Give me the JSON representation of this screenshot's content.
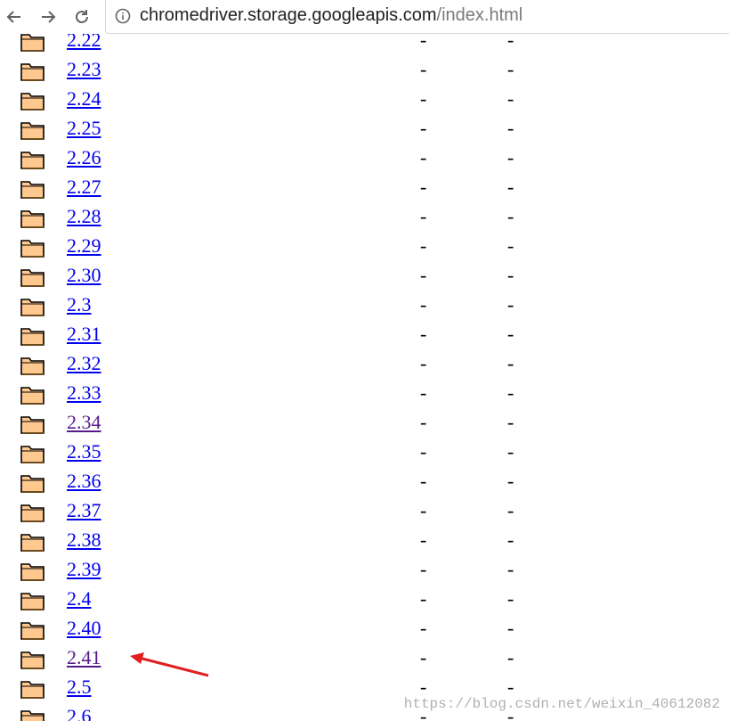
{
  "browser": {
    "url_host": "chromedriver.storage.googleapis.com",
    "url_path": "/index.html",
    "icons": {
      "back": "arrow-left-icon",
      "forward": "arrow-right-icon",
      "reload": "reload-icon",
      "info": "info-icon"
    }
  },
  "listing": {
    "rows": [
      {
        "name": "2.22",
        "col2": "-",
        "col3": "-",
        "visited": false
      },
      {
        "name": "2.23",
        "col2": "-",
        "col3": "-",
        "visited": false
      },
      {
        "name": "2.24",
        "col2": "-",
        "col3": "-",
        "visited": false
      },
      {
        "name": "2.25",
        "col2": "-",
        "col3": "-",
        "visited": false
      },
      {
        "name": "2.26",
        "col2": "-",
        "col3": "-",
        "visited": false
      },
      {
        "name": "2.27",
        "col2": "-",
        "col3": "-",
        "visited": false
      },
      {
        "name": "2.28",
        "col2": "-",
        "col3": "-",
        "visited": false
      },
      {
        "name": "2.29",
        "col2": "-",
        "col3": "-",
        "visited": false
      },
      {
        "name": "2.30",
        "col2": "-",
        "col3": "-",
        "visited": false
      },
      {
        "name": "2.3",
        "col2": "-",
        "col3": "-",
        "visited": false
      },
      {
        "name": "2.31",
        "col2": "-",
        "col3": "-",
        "visited": false
      },
      {
        "name": "2.32",
        "col2": "-",
        "col3": "-",
        "visited": false
      },
      {
        "name": "2.33",
        "col2": "-",
        "col3": "-",
        "visited": false
      },
      {
        "name": "2.34",
        "col2": "-",
        "col3": "-",
        "visited": true
      },
      {
        "name": "2.35",
        "col2": "-",
        "col3": "-",
        "visited": false
      },
      {
        "name": "2.36",
        "col2": "-",
        "col3": "-",
        "visited": false
      },
      {
        "name": "2.37",
        "col2": "-",
        "col3": "-",
        "visited": false
      },
      {
        "name": "2.38",
        "col2": "-",
        "col3": "-",
        "visited": false
      },
      {
        "name": "2.39",
        "col2": "-",
        "col3": "-",
        "visited": false
      },
      {
        "name": "2.4",
        "col2": "-",
        "col3": "-",
        "visited": false
      },
      {
        "name": "2.40",
        "col2": "-",
        "col3": "-",
        "visited": false
      },
      {
        "name": "2.41",
        "col2": "-",
        "col3": "-",
        "visited": true
      },
      {
        "name": "2.5",
        "col2": "-",
        "col3": "-",
        "visited": false
      },
      {
        "name": "2.6",
        "col2": "-",
        "col3": "-",
        "visited": false
      }
    ]
  },
  "annotation": {
    "arrow_color": "#e02020"
  },
  "colors": {
    "link": "#0000ee",
    "visited": "#551a8b",
    "folder_fill": "#ffc88f"
  },
  "watermark": "https://blog.csdn.net/weixin_40612082"
}
